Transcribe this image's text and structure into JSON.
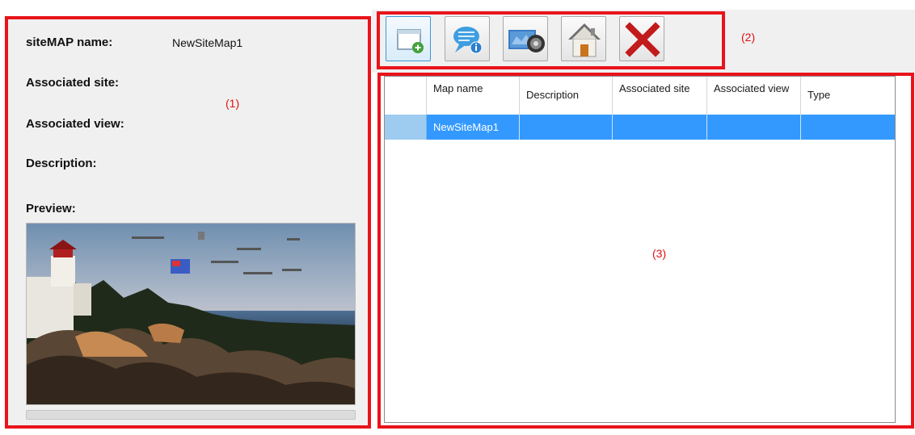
{
  "info": {
    "name_label": "siteMAP name:",
    "name_value": "NewSiteMap1",
    "site_label": "Associated site:",
    "view_label": "Associated view:",
    "description_label": "Description:",
    "preview_label": "Preview:"
  },
  "callouts": {
    "panel": "(1)",
    "toolbar": "(2)",
    "grid": "(3)"
  },
  "toolbar": {
    "buttons": [
      {
        "icon": "new-map-icon"
      },
      {
        "icon": "info-bubble-icon"
      },
      {
        "icon": "map-view-icon"
      },
      {
        "icon": "home-icon"
      },
      {
        "icon": "delete-icon"
      }
    ]
  },
  "grid": {
    "columns": [
      "Map name",
      "Description",
      "Associated site",
      "Associated view",
      "Type"
    ],
    "rows": [
      {
        "map_name": "NewSiteMap1",
        "description": "",
        "site": "",
        "view": "",
        "type": ""
      }
    ],
    "selected_row_color": "#3399ff"
  },
  "colors": {
    "callout": "#e8141b",
    "selection": "#3399ff"
  }
}
